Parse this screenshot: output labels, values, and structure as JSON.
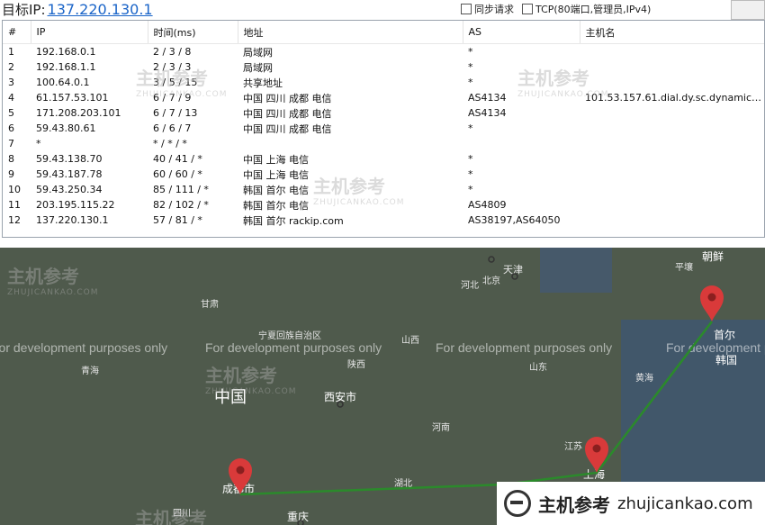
{
  "header": {
    "target_label": "目标IP:",
    "target_ip": "137.220.130.1",
    "opt_sync": "同步请求",
    "opt_tcp": "TCP(80端口,管理员,IPv4)"
  },
  "table": {
    "columns": [
      "#",
      "IP",
      "时间(ms)",
      "地址",
      "AS",
      "主机名"
    ],
    "rows": [
      [
        "1",
        "192.168.0.1",
        "2 / 3 / 8",
        "局域网",
        "*",
        ""
      ],
      [
        "2",
        "192.168.1.1",
        "2 / 3 / 3",
        "局域网",
        "*",
        ""
      ],
      [
        "3",
        "100.64.0.1",
        "3 / 5 / 15",
        "共享地址",
        "*",
        ""
      ],
      [
        "4",
        "61.157.53.101",
        "6 / 7 / 9",
        "中国 四川 成都 电信",
        "AS4134",
        "101.53.157.61.dial.dy.sc.dynamic.1..."
      ],
      [
        "5",
        "171.208.203.101",
        "6 / 7 / 13",
        "中国 四川 成都 电信",
        "AS4134",
        ""
      ],
      [
        "6",
        "59.43.80.61",
        "6 / 6 / 7",
        "中国 四川 成都 电信",
        "*",
        ""
      ],
      [
        "7",
        "*",
        "* / * / *",
        "",
        "",
        ""
      ],
      [
        "8",
        "59.43.138.70",
        "40 / 41 / *",
        "中国 上海 电信",
        "*",
        ""
      ],
      [
        "9",
        "59.43.187.78",
        "60 / 60 / *",
        "中国 上海 电信",
        "*",
        ""
      ],
      [
        "10",
        "59.43.250.34",
        "85 / 111 / *",
        "韩国 首尔 电信",
        "*",
        ""
      ],
      [
        "11",
        "203.195.115.22",
        "82 / 102 / *",
        "韩国 首尔 电信",
        "AS4809",
        ""
      ],
      [
        "12",
        "137.220.130.1",
        "57 / 81 / *",
        "韩国 首尔 rackip.com",
        "AS38197,AS64050",
        ""
      ]
    ]
  },
  "map": {
    "dev_notice": "For development purposes only",
    "labels": {
      "beijing": "北京",
      "tianjin": "天津",
      "hebei": "河北",
      "chaoxian": "朝鲜",
      "pingrang": "平壤",
      "gansu": "甘肃",
      "ningxia": "宁夏回族自治区",
      "shanxi": "山西",
      "shaanxi": "陕西",
      "shandong": "山东",
      "qinghai": "青海",
      "china": "中国",
      "xian": "西安市",
      "henan": "河南",
      "huanghai": "黄海",
      "jiangsu": "江苏",
      "hubei": "湖北",
      "chengdu": "成都市",
      "chongqing": "重庆",
      "sichuan": "四川",
      "shouer": "首尔",
      "hanguo": "韩国",
      "shanghai": "上海"
    }
  },
  "watermark": {
    "cn": "主机参考",
    "en": "ZHUJICANKAO.COM"
  },
  "brand": {
    "name": "主机参考",
    "url": "zhujicankao.com"
  },
  "colors": {
    "route_line": "#2b8a2b",
    "pin": "#d93a3a",
    "link": "#1a64c8"
  }
}
